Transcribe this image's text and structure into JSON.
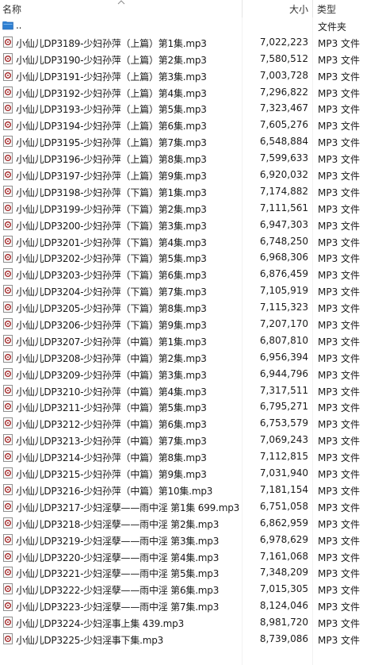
{
  "columns": {
    "name": "名称",
    "size": "大小",
    "type": "类型"
  },
  "parent_row": {
    "name": "..",
    "type": "文件夹"
  },
  "files": [
    {
      "name": "小仙儿DP3189-少妇孙萍（上篇）第1集.mp3",
      "size": "7,022,223",
      "type": "MP3 文件"
    },
    {
      "name": "小仙儿DP3190-少妇孙萍（上篇）第2集.mp3",
      "size": "7,580,512",
      "type": "MP3 文件"
    },
    {
      "name": "小仙儿DP3191-少妇孙萍（上篇）第3集.mp3",
      "size": "7,003,728",
      "type": "MP3 文件"
    },
    {
      "name": "小仙儿DP3192-少妇孙萍（上篇）第4集.mp3",
      "size": "7,296,822",
      "type": "MP3 文件"
    },
    {
      "name": "小仙儿DP3193-少妇孙萍（上篇）第5集.mp3",
      "size": "7,323,467",
      "type": "MP3 文件"
    },
    {
      "name": "小仙儿DP3194-少妇孙萍（上篇）第6集.mp3",
      "size": "7,605,276",
      "type": "MP3 文件"
    },
    {
      "name": "小仙儿DP3195-少妇孙萍（上篇）第7集.mp3",
      "size": "6,548,884",
      "type": "MP3 文件"
    },
    {
      "name": "小仙儿DP3196-少妇孙萍（上篇）第8集.mp3",
      "size": "7,599,633",
      "type": "MP3 文件"
    },
    {
      "name": "小仙儿DP3197-少妇孙萍（上篇）第9集.mp3",
      "size": "6,920,032",
      "type": "MP3 文件"
    },
    {
      "name": "小仙儿DP3198-少妇孙萍（下篇）第1集.mp3",
      "size": "7,174,882",
      "type": "MP3 文件"
    },
    {
      "name": "小仙儿DP3199-少妇孙萍（下篇）第2集.mp3",
      "size": "7,111,561",
      "type": "MP3 文件"
    },
    {
      "name": "小仙儿DP3200-少妇孙萍（下篇）第3集.mp3",
      "size": "6,947,303",
      "type": "MP3 文件"
    },
    {
      "name": "小仙儿DP3201-少妇孙萍（下篇）第4集.mp3",
      "size": "6,748,250",
      "type": "MP3 文件"
    },
    {
      "name": "小仙儿DP3202-少妇孙萍（下篇）第5集.mp3",
      "size": "6,968,306",
      "type": "MP3 文件"
    },
    {
      "name": "小仙儿DP3203-少妇孙萍（下篇）第6集.mp3",
      "size": "6,876,459",
      "type": "MP3 文件"
    },
    {
      "name": "小仙儿DP3204-少妇孙萍（下篇）第7集.mp3",
      "size": "7,105,919",
      "type": "MP3 文件"
    },
    {
      "name": "小仙儿DP3205-少妇孙萍（下篇）第8集.mp3",
      "size": "7,115,323",
      "type": "MP3 文件"
    },
    {
      "name": "小仙儿DP3206-少妇孙萍（下篇）第9集.mp3",
      "size": "7,207,170",
      "type": "MP3 文件"
    },
    {
      "name": "小仙儿DP3207-少妇孙萍（中篇）第1集.mp3",
      "size": "6,807,810",
      "type": "MP3 文件"
    },
    {
      "name": "小仙儿DP3208-少妇孙萍（中篇）第2集.mp3",
      "size": "6,956,394",
      "type": "MP3 文件"
    },
    {
      "name": "小仙儿DP3209-少妇孙萍（中篇）第3集.mp3",
      "size": "6,944,796",
      "type": "MP3 文件"
    },
    {
      "name": "小仙儿DP3210-少妇孙萍（中篇）第4集.mp3",
      "size": "7,317,511",
      "type": "MP3 文件"
    },
    {
      "name": "小仙儿DP3211-少妇孙萍（中篇）第5集.mp3",
      "size": "6,795,271",
      "type": "MP3 文件"
    },
    {
      "name": "小仙儿DP3212-少妇孙萍（中篇）第6集.mp3",
      "size": "6,753,579",
      "type": "MP3 文件"
    },
    {
      "name": "小仙儿DP3213-少妇孙萍（中篇）第7集.mp3",
      "size": "7,069,243",
      "type": "MP3 文件"
    },
    {
      "name": "小仙儿DP3214-少妇孙萍（中篇）第8集.mp3",
      "size": "7,112,815",
      "type": "MP3 文件"
    },
    {
      "name": "小仙儿DP3215-少妇孙萍（中篇）第9集.mp3",
      "size": "7,031,940",
      "type": "MP3 文件"
    },
    {
      "name": "小仙儿DP3216-少妇孙萍（中篇）第10集.mp3",
      "size": "7,181,154",
      "type": "MP3 文件"
    },
    {
      "name": "小仙儿DP3217-少妇淫孽——雨中淫 第1集 699.mp3",
      "size": "6,751,058",
      "type": "MP3 文件"
    },
    {
      "name": "小仙儿DP3218-少妇淫孽——雨中淫 第2集.mp3",
      "size": "6,862,959",
      "type": "MP3 文件"
    },
    {
      "name": "小仙儿DP3219-少妇淫孽——雨中淫 第3集.mp3",
      "size": "6,978,629",
      "type": "MP3 文件"
    },
    {
      "name": "小仙儿DP3220-少妇淫孽——雨中淫 第4集.mp3",
      "size": "7,161,068",
      "type": "MP3 文件"
    },
    {
      "name": "小仙儿DP3221-少妇淫孽——雨中淫 第5集.mp3",
      "size": "7,348,209",
      "type": "MP3 文件"
    },
    {
      "name": "小仙儿DP3222-少妇淫孽——雨中淫 第6集.mp3",
      "size": "7,015,305",
      "type": "MP3 文件"
    },
    {
      "name": "小仙儿DP3223-少妇淫孽——雨中淫 第7集.mp3",
      "size": "8,124,046",
      "type": "MP3 文件"
    },
    {
      "name": "小仙儿DP3224-少妇淫事上集 439.mp3",
      "size": "8,981,720",
      "type": "MP3 文件"
    },
    {
      "name": "小仙儿DP3225-少妇淫事下集.mp3",
      "size": "8,739,086",
      "type": "MP3 文件"
    }
  ],
  "icons": {
    "sort": "sort-up-icon",
    "folder": "folder-up-icon",
    "file": "mp3-file-icon"
  },
  "colors": {
    "folder_icon": "#2f7fd1",
    "file_icon_border": "#9a9a9a",
    "file_icon_dot": "#a52a2a"
  }
}
